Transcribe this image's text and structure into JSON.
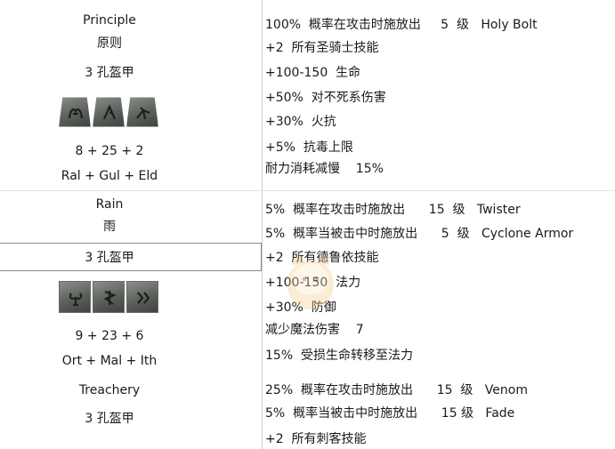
{
  "principle": {
    "name": "Principle",
    "name_cn": "原则",
    "sockets": "3 孔盔甲",
    "levels": "8 + 25 + 2",
    "runes": "Ral + Gul + Eld",
    "rune_icons": [
      "ral-rune-icon",
      "gul-rune-icon",
      "eld-rune-icon"
    ],
    "props": [
      "100%  概率在攻击时施放出     5  级   Holy Bolt",
      "+2  所有圣骑士技能",
      "+100-150  生命",
      "+50%  对不死系伤害",
      "+30%  火抗",
      "+5%  抗毒上限",
      "耐力消耗减慢    15%"
    ]
  },
  "rain": {
    "name": "Rain",
    "name_cn": "雨",
    "sockets": "3 孔盔甲",
    "levels": "9 + 23 + 6",
    "runes": "Ort + Mal + Ith",
    "rune_icons": [
      "ort-rune-icon",
      "mal-rune-icon",
      "ith-rune-icon"
    ],
    "props": [
      "5%  概率在攻击时施放出      15  级   Twister",
      "5%  概率当被击中时施放出      5  级   Cyclone Armor",
      "+2  所有德鲁依技能",
      "+100-150  法力",
      "+30%  防御",
      "减少魔法伤害    7",
      "15%  受损生命转移至法力"
    ]
  },
  "treachery": {
    "name": "Treachery",
    "sockets": "3 孔盔甲",
    "props": [
      "25%  概率在攻击时施放出      15  级   Venom",
      "5%  概率当被击中时施放出      15 级   Fade",
      "+2  所有刺客技能"
    ]
  }
}
